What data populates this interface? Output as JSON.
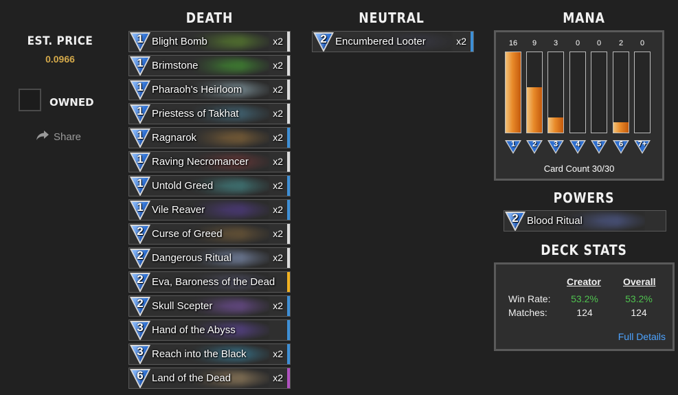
{
  "est_price": {
    "label": "EST. PRICE",
    "value": "0.0966"
  },
  "owned_label": "OWNED",
  "share_label": "Share",
  "sections": {
    "death": "DEATH",
    "neutral": "NEUTRAL",
    "mana": "MANA",
    "powers": "POWERS",
    "deck_stats": "DECK STATS"
  },
  "death_cards": [
    {
      "cost": "1",
      "name": "Blight Bomb",
      "count": "x2",
      "rarity": "#dcdcdc",
      "art": "#6aa12e"
    },
    {
      "cost": "1",
      "name": "Brimstone",
      "count": "x2",
      "rarity": "#dcdcdc",
      "art": "#49b832"
    },
    {
      "cost": "1",
      "name": "Pharaoh's Heirloom",
      "count": "x2",
      "rarity": "#dcdcdc",
      "art": "#a8c9d6"
    },
    {
      "cost": "1",
      "name": "Priestess of Takhat",
      "count": "x2",
      "rarity": "#dcdcdc",
      "art": "#4c86a0"
    },
    {
      "cost": "1",
      "name": "Ragnarok",
      "count": "x2",
      "rarity": "#3d8fd6",
      "art": "#a87a3a"
    },
    {
      "cost": "1",
      "name": "Raving Necromancer",
      "count": "x2",
      "rarity": "#dcdcdc",
      "art": "#8a3a3a"
    },
    {
      "cost": "1",
      "name": "Untold Greed",
      "count": "x2",
      "rarity": "#3d8fd6",
      "art": "#4aa6a6"
    },
    {
      "cost": "1",
      "name": "Vile Reaver",
      "count": "x2",
      "rarity": "#3d8fd6",
      "art": "#5c3ea6"
    },
    {
      "cost": "2",
      "name": "Curse of Greed",
      "count": "x2",
      "rarity": "#dcdcdc",
      "art": "#8a6a3a"
    },
    {
      "cost": "2",
      "name": "Dangerous Ritual",
      "count": "x2",
      "rarity": "#dcdcdc",
      "art": "#9ab0e0"
    },
    {
      "cost": "2",
      "name": "Eva, Baroness of the Dead",
      "count": "",
      "rarity": "#f0b020",
      "art": "#5a5a7a"
    },
    {
      "cost": "2",
      "name": "Skull Scepter",
      "count": "x2",
      "rarity": "#3d8fd6",
      "art": "#8a5ac0"
    },
    {
      "cost": "3",
      "name": "Hand of the Abyss",
      "count": "",
      "rarity": "#3d8fd6",
      "art": "#6a4ab8"
    },
    {
      "cost": "3",
      "name": "Reach into the Black",
      "count": "x2",
      "rarity": "#3d8fd6",
      "art": "#3aa0c8"
    },
    {
      "cost": "6",
      "name": "Land of the Dead",
      "count": "x2",
      "rarity": "#b050c0",
      "art": "#c0a070"
    }
  ],
  "neutral_cards": [
    {
      "cost": "2",
      "name": "Encumbered Looter",
      "count": "x2",
      "rarity": "#3d8fd6",
      "art": "#3a3a4a"
    }
  ],
  "mana": {
    "counts": [
      16,
      9,
      3,
      0,
      0,
      2,
      0
    ],
    "max": 16,
    "labels": [
      "1",
      "2",
      "3",
      "4",
      "5",
      "6",
      "7+"
    ],
    "card_count": "Card Count 30/30"
  },
  "powers": [
    {
      "cost": "2",
      "name": "Blood Ritual",
      "art": "#5a6ab0"
    }
  ],
  "deck_stats": {
    "creator_label": "Creator",
    "overall_label": "Overall",
    "win_rate_label": "Win Rate:",
    "matches_label": "Matches:",
    "creator_win_rate": "53.2%",
    "overall_win_rate": "53.2%",
    "creator_matches": "124",
    "overall_matches": "124",
    "full_details": "Full Details"
  }
}
